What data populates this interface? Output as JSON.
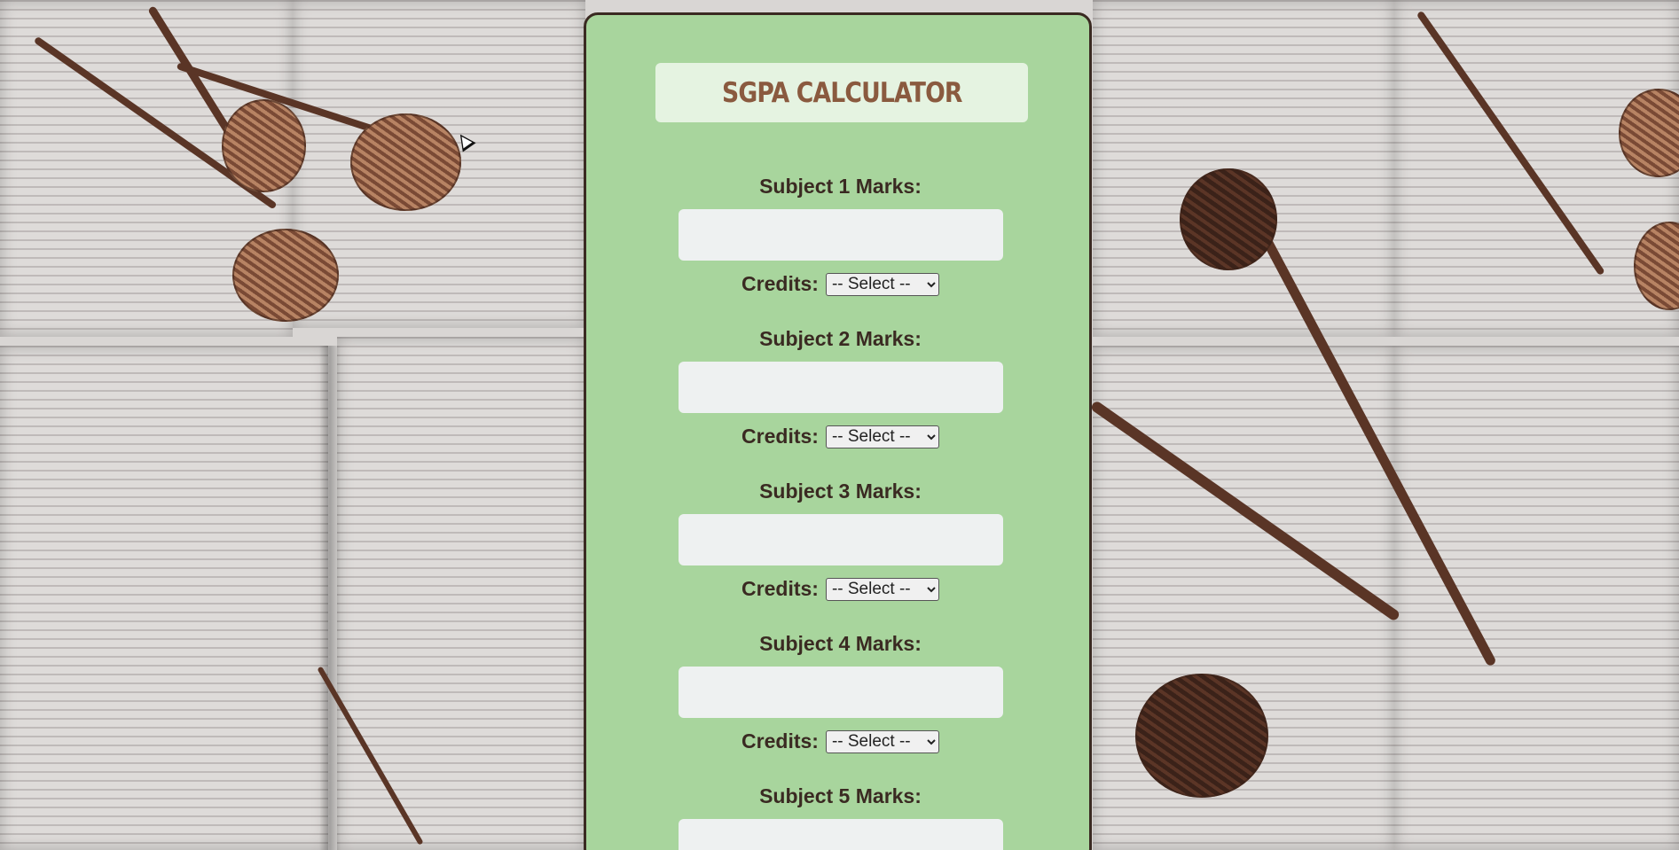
{
  "app": {
    "title": "SGPA CALCULATOR"
  },
  "subjects": [
    {
      "marks_label": "Subject 1 Marks:",
      "marks_value": "",
      "credits_label": "Credits:",
      "credits_selected": "-- Select --"
    },
    {
      "marks_label": "Subject 2 Marks:",
      "marks_value": "",
      "credits_label": "Credits:",
      "credits_selected": "-- Select --"
    },
    {
      "marks_label": "Subject 3 Marks:",
      "marks_value": "",
      "credits_label": "Credits:",
      "credits_selected": "-- Select --"
    },
    {
      "marks_label": "Subject 4 Marks:",
      "marks_value": "",
      "credits_label": "Credits:",
      "credits_selected": "-- Select --"
    },
    {
      "marks_label": "Subject 5 Marks:",
      "marks_value": ""
    }
  ],
  "colors": {
    "card_background": "#a8d59d",
    "card_border": "#3a2a22",
    "title_box": "#e5f3e1",
    "title_text": "#8a5a3f",
    "label_text": "#3a2a22",
    "input_background": "#eef1f1"
  }
}
